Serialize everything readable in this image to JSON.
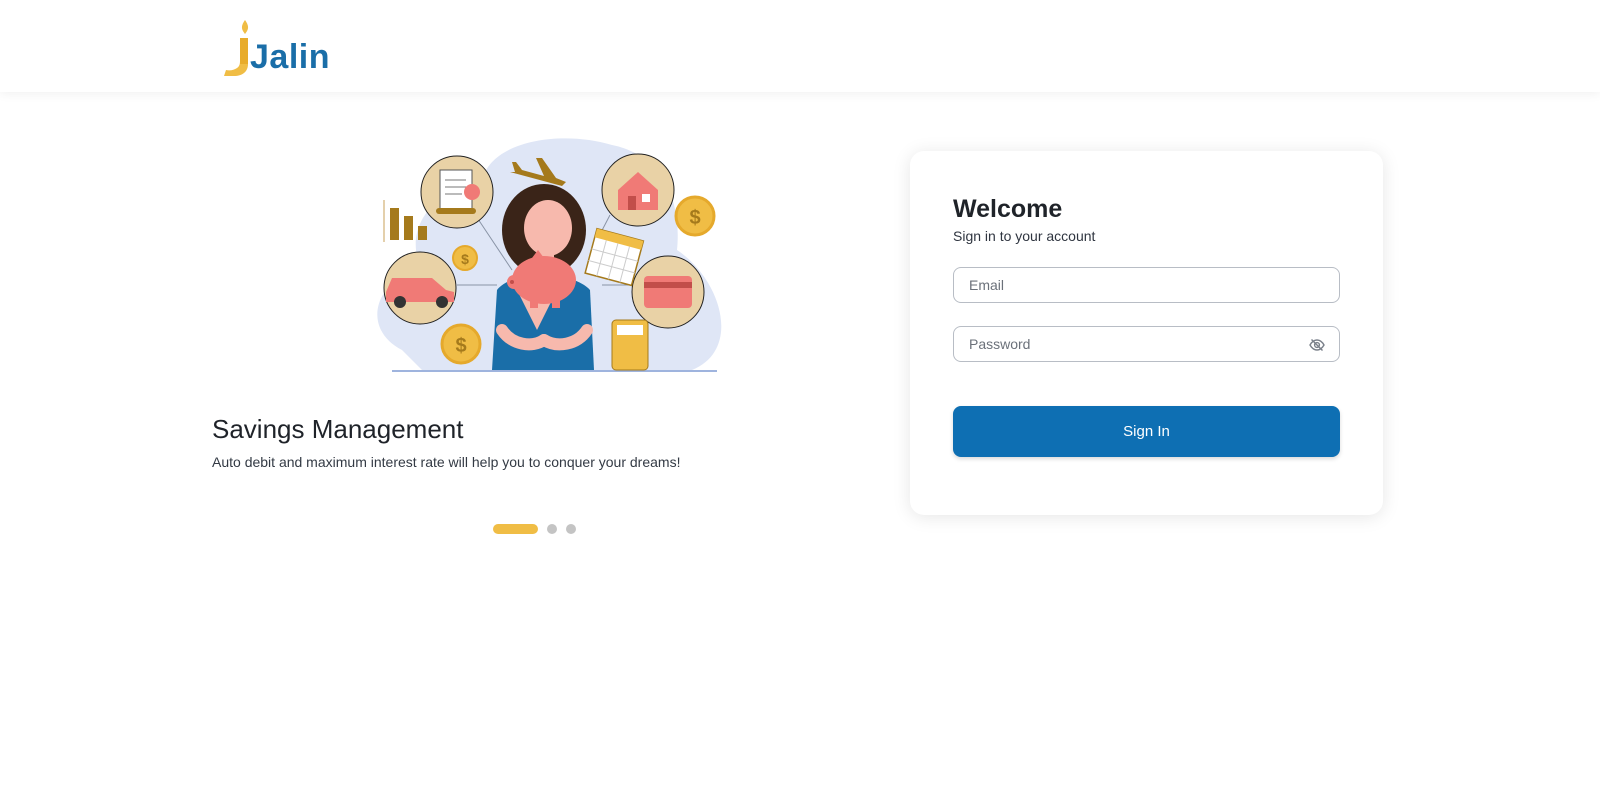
{
  "header": {
    "logo_text": "Jalin",
    "logo_icon": "flame-icon",
    "brand_color": "#1a6ea8",
    "accent_color": "#f0bd45"
  },
  "hero": {
    "illustration": "savings-illustration-icon",
    "title": "Savings Management",
    "description": "Auto debit and maximum interest rate will help you to conquer your dreams!",
    "carousel": {
      "total_slides": 3,
      "active_index": 0
    }
  },
  "login": {
    "title": "Welcome",
    "subtitle": "Sign in to your account",
    "email": {
      "placeholder": "Email",
      "value": ""
    },
    "password": {
      "placeholder": "Password",
      "value": "",
      "toggle_icon": "eye-off-icon"
    },
    "submit_label": "Sign In",
    "button_color": "#0e6fb3"
  }
}
